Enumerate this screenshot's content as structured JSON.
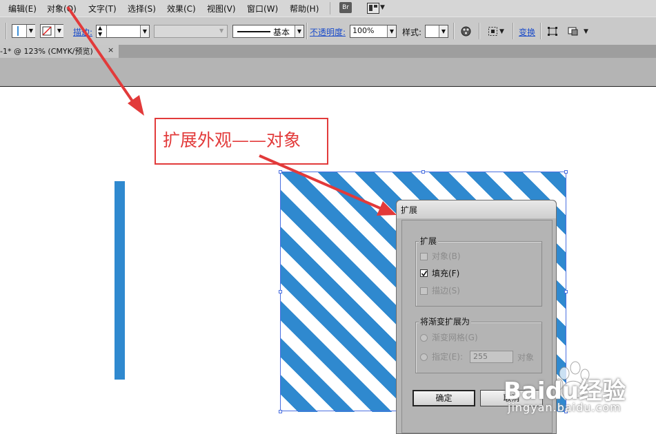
{
  "menubar": {
    "items": [
      "编辑(E)",
      "对象(O)",
      "文字(T)",
      "选择(S)",
      "效果(C)",
      "视图(V)",
      "窗口(W)",
      "帮助(H)"
    ],
    "bridge_label": "Br"
  },
  "controlbar": {
    "stroke_link": "描边:",
    "stroke_profile": "基本",
    "opacity_link": "不透明度:",
    "opacity_value": "100%",
    "style_label": "样式:",
    "transform_link": "变换"
  },
  "document_tab": {
    "title": "-1* @ 123% (CMYK/预览)",
    "close_glyph": "×"
  },
  "canvas": {
    "bar_color": "#2f89cf",
    "stripe_color": "#2f89cf",
    "selection_color": "#4a6fe0"
  },
  "annotation": {
    "callout_text": "扩展外观——对象",
    "color": "#e23a3a"
  },
  "dialog": {
    "title": "扩展",
    "expand_group": {
      "legend": "扩展",
      "object_label": "对象(B)",
      "object_checked": false,
      "fill_label": "填充(F)",
      "fill_checked": true,
      "stroke_label": "描边(S)",
      "stroke_checked": false
    },
    "gradient_group": {
      "legend": "将渐变扩展为",
      "mesh_label": "渐变网格(G)",
      "specify_label": "指定(E):",
      "specify_value": "255",
      "specify_unit": "对象"
    },
    "ok_label": "确定",
    "cancel_label": "取消"
  },
  "watermark": {
    "brand": "Baidu经验",
    "url": "jingyan.baidu.com"
  }
}
